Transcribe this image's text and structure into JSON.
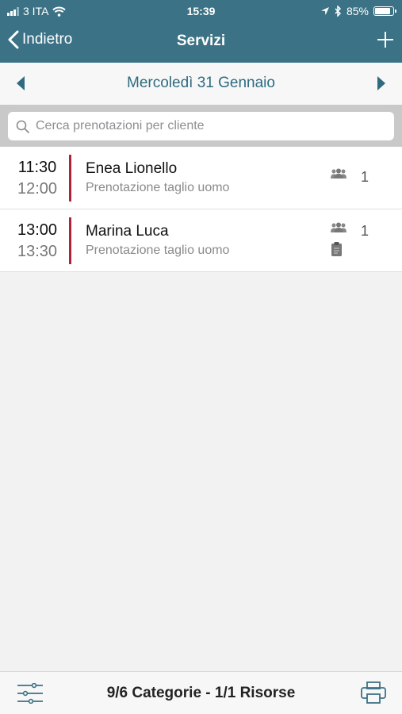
{
  "status_bar": {
    "carrier": "3 ITA",
    "time": "15:39",
    "battery": "85%",
    "battery_level": 0.85,
    "icons": [
      "signal-icon",
      "wifi-icon",
      "location-icon",
      "bluetooth-icon",
      "battery-icon"
    ]
  },
  "nav": {
    "back_label": "Indietro",
    "title": "Servizi",
    "add_icon": "plus-icon"
  },
  "date_bar": {
    "date": "Mercoledì 31 Gennaio"
  },
  "search": {
    "placeholder": "Cerca prenotazioni per cliente"
  },
  "bookings": [
    {
      "start": "11:30",
      "end": "12:00",
      "name": "Enea Lionello",
      "description": "Prenotazione taglio uomo",
      "people": "1",
      "has_note": false
    },
    {
      "start": "13:00",
      "end": "13:30",
      "name": "Marina Luca",
      "description": "Prenotazione taglio uomo",
      "people": "1",
      "has_note": true
    }
  ],
  "footer": {
    "summary": "9/6 Categorie - 1/1 Risorse"
  },
  "colors": {
    "header": "#3b7285",
    "accent_text": "#2f6b80",
    "booking_bar": "#b0243a"
  }
}
